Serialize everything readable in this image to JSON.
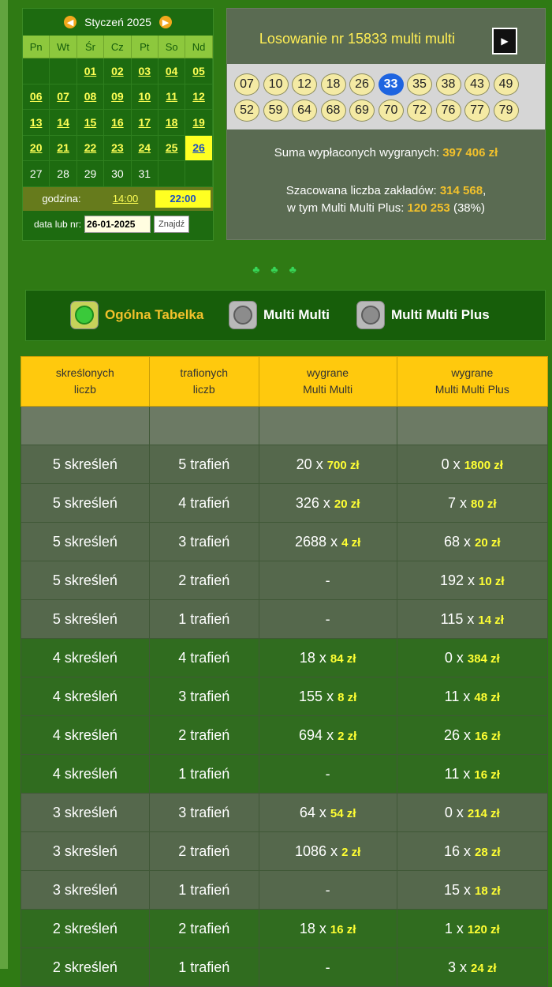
{
  "calendar": {
    "month_label": "Styczeń 2025",
    "prev_icon": "arrow-left-icon",
    "next_icon": "arrow-right-icon",
    "weekdays": [
      "Pn",
      "Wt",
      "Śr",
      "Cz",
      "Pt",
      "So",
      "Nd"
    ],
    "days": [
      [
        "",
        "",
        "01",
        "02",
        "03",
        "04",
        "05"
      ],
      [
        "06",
        "07",
        "08",
        "09",
        "10",
        "11",
        "12"
      ],
      [
        "13",
        "14",
        "15",
        "16",
        "17",
        "18",
        "19"
      ],
      [
        "20",
        "21",
        "22",
        "23",
        "24",
        "25",
        "26"
      ],
      [
        "27",
        "28",
        "29",
        "30",
        "31",
        "",
        ""
      ]
    ],
    "selected_day": "26",
    "hour_label": "godzina:",
    "hours": [
      "14:00",
      "22:00"
    ],
    "selected_hour": "22:00",
    "search_label": "data lub nr:",
    "search_value": "26-01-2025",
    "search_button": "Znajdź"
  },
  "draw": {
    "title": "Losowanie nr 15833 multi multi",
    "video_icon": "film-icon",
    "numbers": [
      "07",
      "10",
      "12",
      "18",
      "26",
      "33",
      "35",
      "38",
      "43",
      "49",
      "52",
      "59",
      "64",
      "68",
      "69",
      "70",
      "72",
      "76",
      "77",
      "79"
    ],
    "highlighted_number": "33",
    "payout_label": "Suma wypłaconych wygranych: ",
    "payout_value": "397 406 zł",
    "bets_label": "Szacowana liczba zakładów: ",
    "bets_value": "314 568",
    "plus_label": "w tym Multi Multi Plus: ",
    "plus_value": "120 253",
    "plus_pct": " (38%)"
  },
  "decor": {
    "clubs": "♣♣♣"
  },
  "tabs": [
    {
      "label": "Ogólna Tabelka",
      "active": true
    },
    {
      "label": "Multi Multi",
      "active": false
    },
    {
      "label": "Multi Multi Plus",
      "active": false
    }
  ],
  "table": {
    "headers": [
      [
        "skreślonych",
        "liczb"
      ],
      [
        "trafionych",
        "liczb"
      ],
      [
        "wygrane",
        "Multi Multi"
      ],
      [
        "wygrane",
        "Multi Multi Plus"
      ]
    ],
    "rows": [
      {
        "group": "gray",
        "picked": "5 skreśleń",
        "hit": "5 trafień",
        "mm_count": "20",
        "mm_prize": "700 zł",
        "plus_count": "0",
        "plus_prize": "1800 zł"
      },
      {
        "group": "gray",
        "picked": "5 skreśleń",
        "hit": "4 trafień",
        "mm_count": "326",
        "mm_prize": "20 zł",
        "plus_count": "7",
        "plus_prize": "80 zł"
      },
      {
        "group": "gray",
        "picked": "5 skreśleń",
        "hit": "3 trafień",
        "mm_count": "2688",
        "mm_prize": "4 zł",
        "plus_count": "68",
        "plus_prize": "20 zł"
      },
      {
        "group": "gray",
        "picked": "5 skreśleń",
        "hit": "2 trafień",
        "mm_count": "-",
        "mm_prize": "",
        "plus_count": "192",
        "plus_prize": "10 zł"
      },
      {
        "group": "gray",
        "picked": "5 skreśleń",
        "hit": "1 trafień",
        "mm_count": "-",
        "mm_prize": "",
        "plus_count": "115",
        "plus_prize": "14 zł"
      },
      {
        "group": "green",
        "picked": "4 skreśleń",
        "hit": "4 trafień",
        "mm_count": "18",
        "mm_prize": "84 zł",
        "plus_count": "0",
        "plus_prize": "384 zł"
      },
      {
        "group": "green",
        "picked": "4 skreśleń",
        "hit": "3 trafień",
        "mm_count": "155",
        "mm_prize": "8 zł",
        "plus_count": "11",
        "plus_prize": "48 zł"
      },
      {
        "group": "green",
        "picked": "4 skreśleń",
        "hit": "2 trafień",
        "mm_count": "694",
        "mm_prize": "2 zł",
        "plus_count": "26",
        "plus_prize": "16 zł"
      },
      {
        "group": "green",
        "picked": "4 skreśleń",
        "hit": "1 trafień",
        "mm_count": "-",
        "mm_prize": "",
        "plus_count": "11",
        "plus_prize": "16 zł"
      },
      {
        "group": "gray",
        "picked": "3 skreśleń",
        "hit": "3 trafień",
        "mm_count": "64",
        "mm_prize": "54 zł",
        "plus_count": "0",
        "plus_prize": "214 zł"
      },
      {
        "group": "gray",
        "picked": "3 skreśleń",
        "hit": "2 trafień",
        "mm_count": "1086",
        "mm_prize": "2 zł",
        "plus_count": "16",
        "plus_prize": "28 zł"
      },
      {
        "group": "gray",
        "picked": "3 skreśleń",
        "hit": "1 trafień",
        "mm_count": "-",
        "mm_prize": "",
        "plus_count": "15",
        "plus_prize": "18 zł"
      },
      {
        "group": "green",
        "picked": "2 skreśleń",
        "hit": "2 trafień",
        "mm_count": "18",
        "mm_prize": "16 zł",
        "plus_count": "1",
        "plus_prize": "120 zł"
      },
      {
        "group": "green",
        "picked": "2 skreśleń",
        "hit": "1 trafień",
        "mm_count": "-",
        "mm_prize": "",
        "plus_count": "3",
        "plus_prize": "24 zł"
      }
    ]
  }
}
